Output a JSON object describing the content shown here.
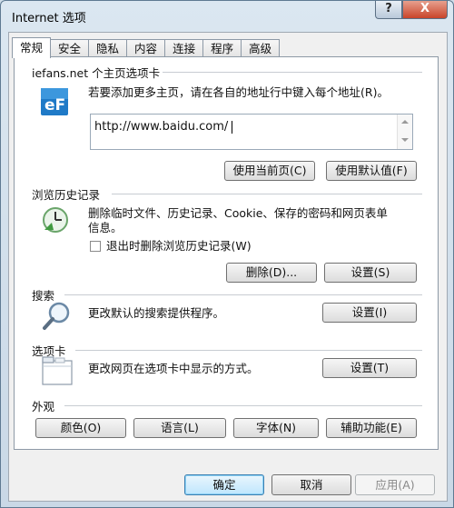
{
  "window": {
    "title": "Internet 选项",
    "help_label": "?",
    "close_label": "X"
  },
  "tabs": [
    {
      "label": "常规",
      "active": true
    },
    {
      "label": "安全"
    },
    {
      "label": "隐私"
    },
    {
      "label": "内容"
    },
    {
      "label": "连接"
    },
    {
      "label": "程序"
    },
    {
      "label": "高级"
    }
  ],
  "homepage": {
    "header": "iefans.net 个主页选项卡",
    "instruction": "若要添加更多主页，请在各自的地址行中键入每个地址(R)。",
    "address": "http://www.baidu.com/",
    "use_current_button": "使用当前页(C)",
    "use_default_button": "使用默认值(F)"
  },
  "history": {
    "header": "浏览历史记录",
    "description_line1": "删除临时文件、历史记录、Cookie、保存的密码和网页表单",
    "description_line2": "信息。",
    "delete_on_exit_label": "退出时删除浏览历史记录(W)",
    "delete_on_exit_checked": false,
    "delete_button": "删除(D)...",
    "settings_button": "设置(S)"
  },
  "search": {
    "header": "搜索",
    "description": "更改默认的搜索提供程序。",
    "settings_button": "设置(I)"
  },
  "tabbed": {
    "header": "选项卡",
    "description": "更改网页在选项卡中显示的方式。",
    "settings_button": "设置(T)"
  },
  "appearance": {
    "header": "外观",
    "buttons": [
      "颜色(O)",
      "语言(L)",
      "字体(N)",
      "辅助功能(E)"
    ]
  },
  "footer": {
    "ok": "确定",
    "cancel": "取消",
    "apply": "应用(A)"
  },
  "icons": {
    "homepage": "ie-logo-icon",
    "history": "clock-icon",
    "search": "magnifier-icon",
    "tabs": "tab-window-icon"
  },
  "colors": {
    "accent": "#3c7fb1",
    "title_bar": "#cfdde9",
    "close_button": "#c9442a"
  }
}
